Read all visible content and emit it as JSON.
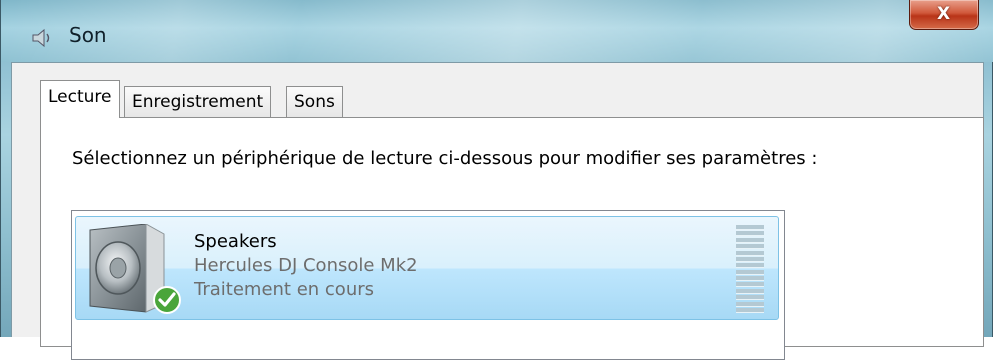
{
  "window": {
    "title": "Son",
    "close_glyph": "X",
    "accent_close": "#c7472a",
    "frame_color": "#8fc0d2"
  },
  "tabs": [
    {
      "label": "Lecture",
      "active": true
    },
    {
      "label": "Enregistrement",
      "active": false
    },
    {
      "label": "Sons",
      "active": false
    }
  ],
  "playback": {
    "instruction": "Sélectionnez un périphérique de lecture ci-dessous pour modifier ses paramètres :",
    "devices": [
      {
        "name": "Speakers",
        "description": "Hercules DJ Console Mk2",
        "status": "Traitement en cours",
        "icon": "speaker-icon",
        "badge": "default-check-icon",
        "selected": true,
        "level": 0
      }
    ]
  }
}
